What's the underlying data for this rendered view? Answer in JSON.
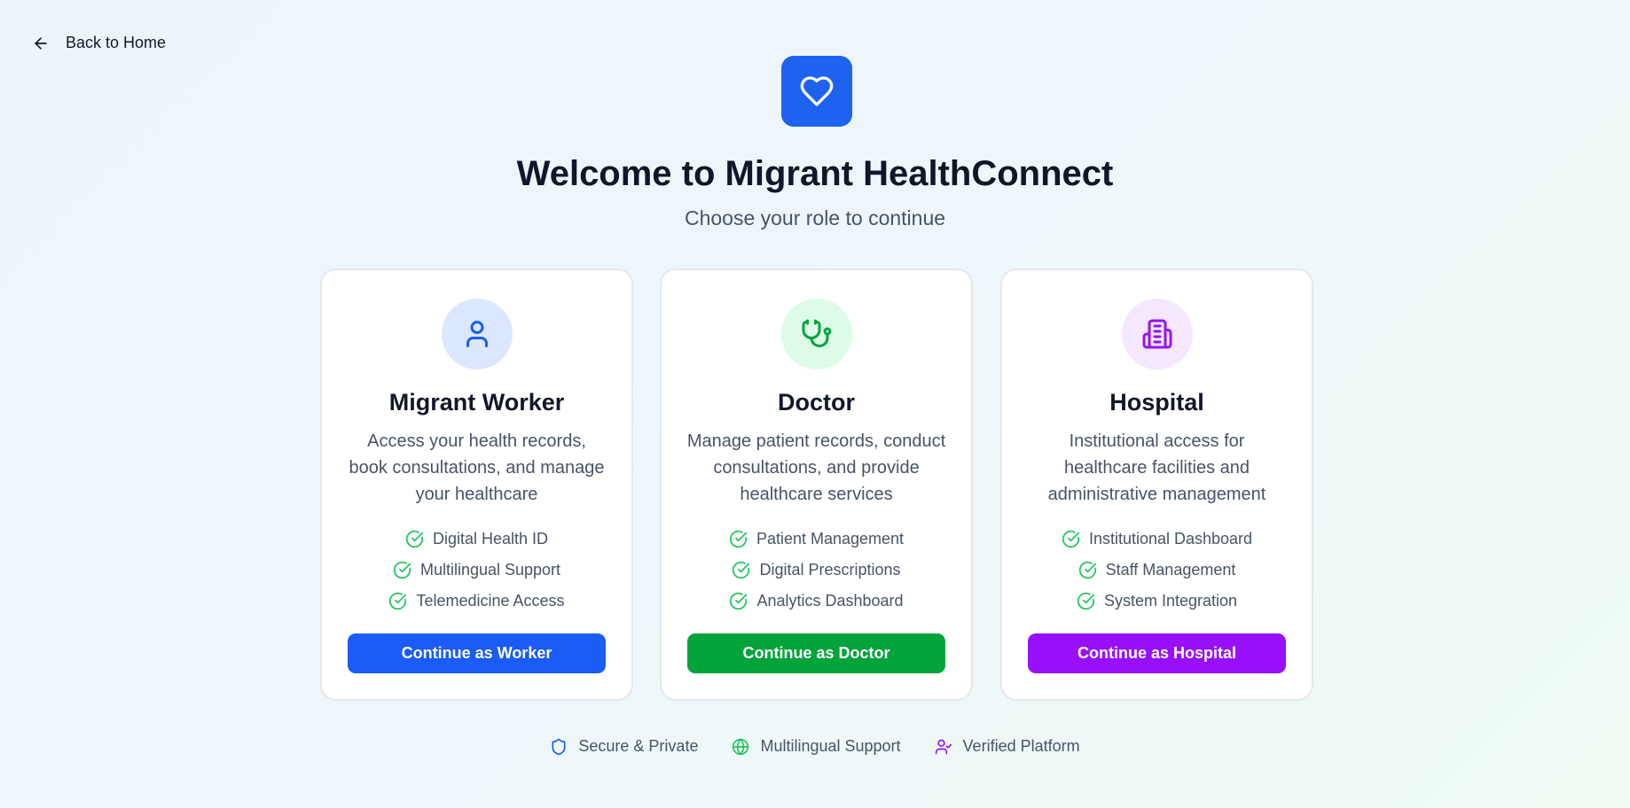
{
  "nav": {
    "back_label": "Back to Home",
    "back_icon": "arrow-left-icon"
  },
  "header": {
    "logo_icon": "heart-icon",
    "title": "Welcome to Migrant HealthConnect",
    "subtitle": "Choose your role to continue"
  },
  "colors": {
    "primary_blue": "#1d63f0",
    "worker_blue": "#1a5cf5",
    "doctor_green": "#03a33c",
    "hospital_purple": "#9810fa",
    "check_green": "#22c55e"
  },
  "roles": [
    {
      "icon": "user-icon",
      "title": "Migrant Worker",
      "description": "Access your health records, book consultations, and manage your healthcare",
      "features": [
        "Digital Health ID",
        "Multilingual Support",
        "Telemedicine Access"
      ],
      "button": "Continue as Worker"
    },
    {
      "icon": "stethoscope-icon",
      "title": "Doctor",
      "description": "Manage patient records, conduct consultations, and provide healthcare services",
      "features": [
        "Patient Management",
        "Digital Prescriptions",
        "Analytics Dashboard"
      ],
      "button": "Continue as Doctor"
    },
    {
      "icon": "building-icon",
      "title": "Hospital",
      "description": "Institutional access for healthcare facilities and administrative management",
      "features": [
        "Institutional Dashboard",
        "Staff Management",
        "System Integration"
      ],
      "button": "Continue as Hospital"
    }
  ],
  "footer": [
    {
      "icon": "shield-icon",
      "label": "Secure & Private"
    },
    {
      "icon": "globe-icon",
      "label": "Multilingual Support"
    },
    {
      "icon": "user-check-icon",
      "label": "Verified Platform"
    }
  ]
}
